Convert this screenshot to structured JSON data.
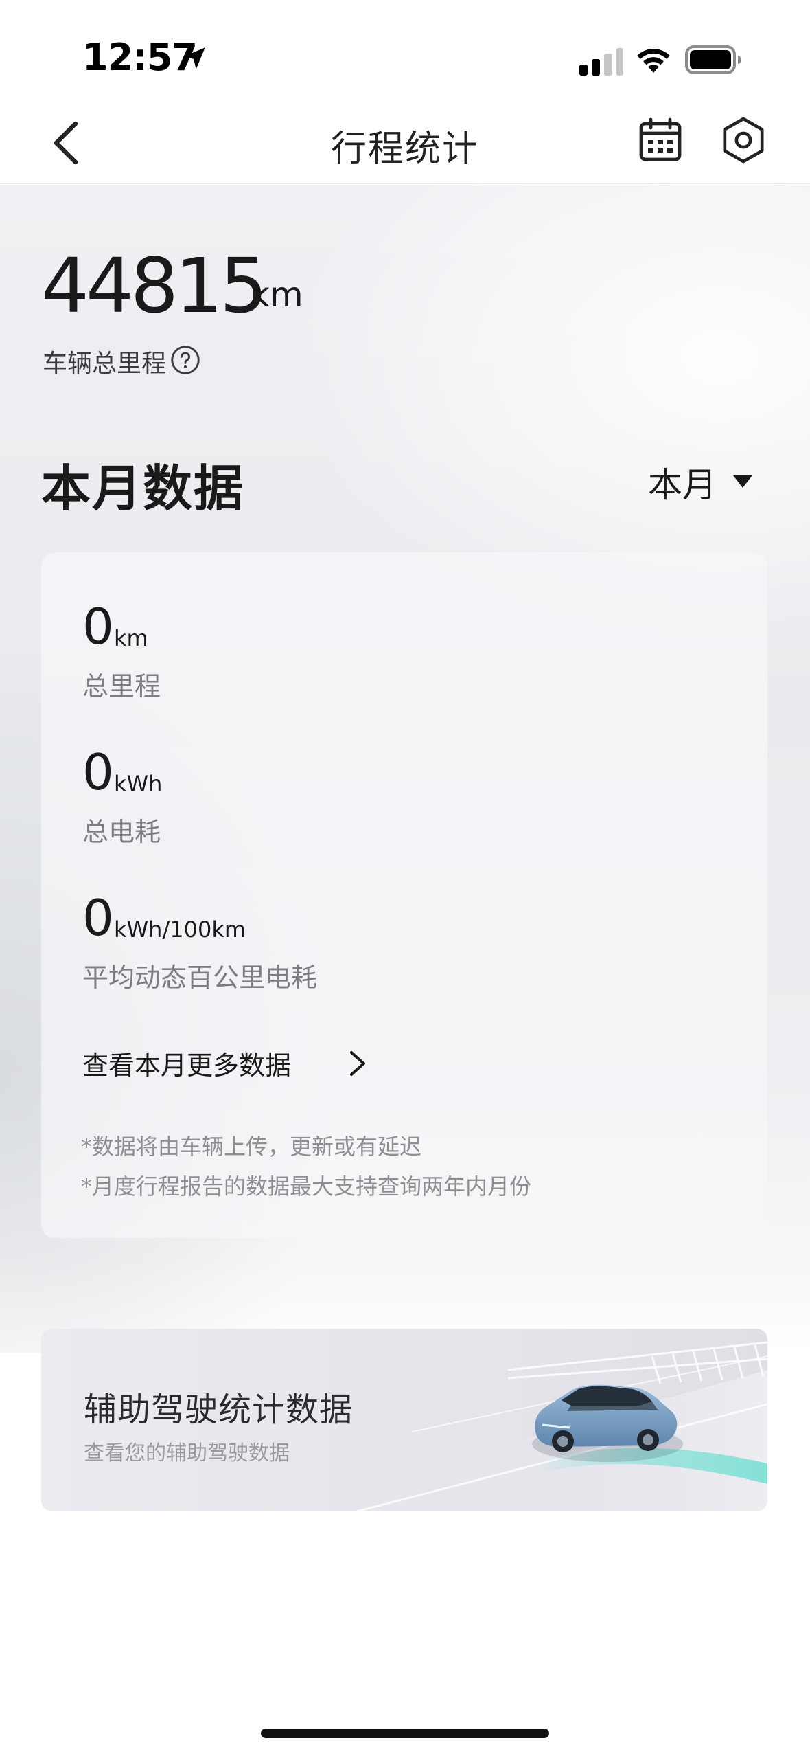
{
  "status_bar": {
    "time": "12:57",
    "icons": [
      "location-arrow-icon",
      "cellular-signal-icon",
      "wifi-icon",
      "battery-icon"
    ]
  },
  "nav": {
    "title": "行程统计",
    "back_icon": "chevron-left-icon",
    "calendar_icon": "calendar-icon",
    "settings_icon": "hexagon-settings-icon"
  },
  "odometer": {
    "value": "44815",
    "unit": "km",
    "label": "车辆总里程",
    "help_icon": "question-circle-icon"
  },
  "monthly": {
    "title": "本月数据",
    "period_selector": "本月",
    "metrics": [
      {
        "value": "0",
        "unit": "km",
        "label": "总里程"
      },
      {
        "value": "0",
        "unit": "kWh",
        "label": "总电耗"
      },
      {
        "value": "0",
        "unit": "kWh/100km",
        "label": "平均动态百公里电耗"
      }
    ],
    "more_link": "查看本月更多数据",
    "notes": [
      "*数据将由车辆上传，更新或有延迟",
      "*月度行程报告的数据最大支持查询两年内月份"
    ]
  },
  "assist": {
    "title": "辅助驾驶统计数据",
    "subtitle": "查看您的辅助驾驶数据"
  },
  "colors": {
    "accent_teal": "#7fe0d6",
    "car_blue": "#7fa6c8",
    "text_primary": "#1a1a1a",
    "text_secondary": "#7c7c82"
  }
}
